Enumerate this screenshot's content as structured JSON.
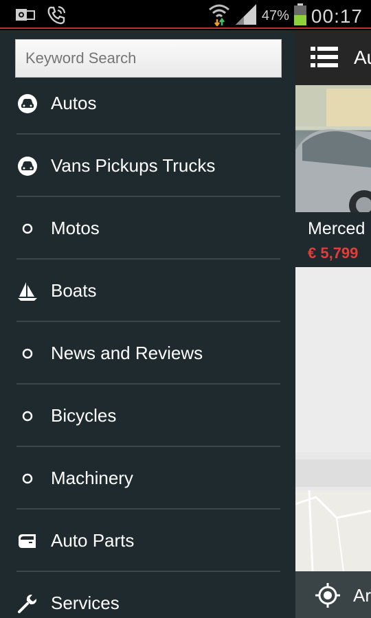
{
  "status_bar": {
    "left_icons": [
      "outlook-icon",
      "phone-call-icon"
    ],
    "right_icons": [
      "wifi-icon",
      "signal-icon"
    ],
    "battery_percent": "47%",
    "time": "00:17"
  },
  "drawer": {
    "search": {
      "placeholder": "Keyword Search"
    },
    "items": [
      {
        "label": "Autos",
        "icon": "car-icon"
      },
      {
        "label": "Vans Pickups Trucks",
        "icon": "car-icon"
      },
      {
        "label": "Motos",
        "icon": "circle-icon"
      },
      {
        "label": "Boats",
        "icon": "sailboat-icon"
      },
      {
        "label": "News and Reviews",
        "icon": "circle-icon"
      },
      {
        "label": "Bicycles",
        "icon": "circle-icon"
      },
      {
        "label": "Machinery",
        "icon": "circle-icon"
      },
      {
        "label": "Auto Parts",
        "icon": "car-door-icon"
      },
      {
        "label": "Services",
        "icon": "wrench-icon"
      }
    ]
  },
  "content": {
    "title": "Au",
    "listing": {
      "title": "Merced",
      "price": "€ 5,799"
    },
    "bottom_bar": {
      "label": "Ar"
    },
    "colors": {
      "accent": "#e43b3b",
      "drawer_bg": "#1e2a2d"
    }
  }
}
